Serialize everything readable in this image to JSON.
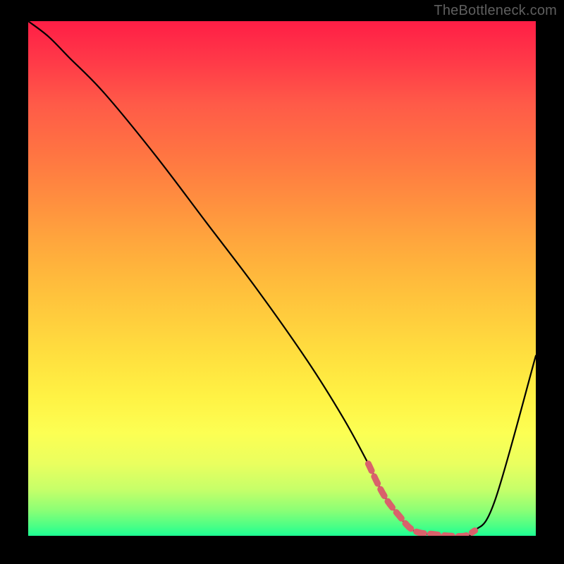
{
  "watermark": "TheBottleneck.com",
  "chart_data": {
    "type": "line",
    "title": "",
    "xlabel": "",
    "ylabel": "",
    "xlim": [
      0,
      100
    ],
    "ylim": [
      0,
      100
    ],
    "series": [
      {
        "name": "bottleneck-curve",
        "x": [
          0,
          4,
          8,
          15,
          25,
          35,
          45,
          55,
          62,
          67,
          70,
          73,
          76,
          82,
          86,
          88,
          92,
          100
        ],
        "values": [
          100,
          97,
          93,
          86,
          74,
          61,
          48,
          34,
          23,
          14,
          8,
          4,
          1,
          0,
          0,
          1,
          7,
          35
        ]
      },
      {
        "name": "highlight-segment",
        "x": [
          67,
          70,
          73,
          76,
          80,
          83,
          86,
          88
        ],
        "values": [
          14,
          8,
          4,
          1,
          0.3,
          0,
          0,
          1
        ]
      }
    ],
    "background_gradient": {
      "top": "#ff1e46",
      "middle": "#ffe23f",
      "bottom": "#1dff93"
    },
    "colors": {
      "curve": "#000000",
      "highlight": "#d9616b",
      "frame": "#000000"
    }
  }
}
